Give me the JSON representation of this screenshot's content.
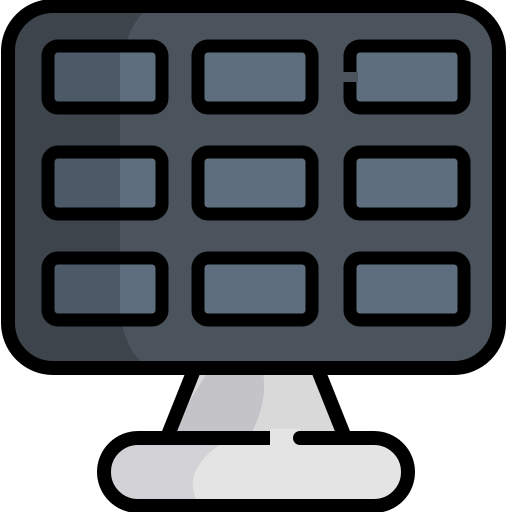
{
  "icon": {
    "name": "solar-panel-icon",
    "style": "filled-outline",
    "grid": {
      "rows": 3,
      "columns": 3
    }
  },
  "colors": {
    "outline": "#000000",
    "panel": "#4b535d",
    "panel_shade": "#3d444c",
    "cell": "#5e6e7e",
    "cell_shade": "#4c5966",
    "stand": "#d9d9d9",
    "stand_shade": "#c4c4c8",
    "base": "#e4e4e4",
    "base_shade": "#d2d2d6"
  }
}
